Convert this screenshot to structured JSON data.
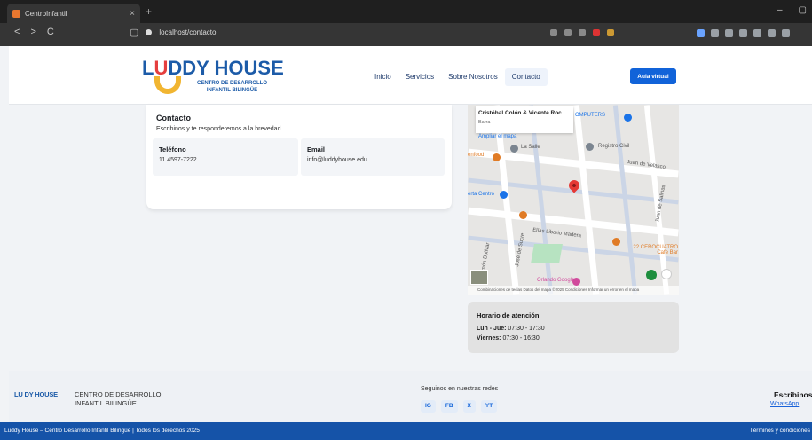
{
  "browser": {
    "tab_title": "CentroInfantil",
    "tab_close": "×",
    "new_tab": "+",
    "url": "localhost/contacto",
    "nav": {
      "back": "<",
      "forward": ">",
      "reload": "C"
    }
  },
  "header": {
    "logo": {
      "l": "L",
      "u": "U",
      "d": "D",
      "rest": "DY HOUSE",
      "sub1": "CENTRO DE DESARROLLO",
      "sub2": "INFANTIL BILINGÜE"
    },
    "menu": [
      "Inicio",
      "Servicios",
      "Sobre Nosotros",
      "Contacto"
    ],
    "active_menu": "Contacto",
    "cta": "Aula virtual"
  },
  "contact": {
    "title": "Contacto",
    "subtitle": "Escribinos y te responderemos a la brevedad.",
    "phone_label": "Teléfono",
    "phone_value": "11 4597-7222",
    "email_label": "Email",
    "email_value": "info@luddyhouse.edu"
  },
  "map": {
    "tooltip_title": "Cristóbal Colón & Vicente Roc...",
    "tooltip_sub": "Barra",
    "expand_link": "Ampliar el mapa",
    "labels": {
      "registro": "Registro Civil",
      "lasalle": "La Salle",
      "velasco": "Juan de Velasco",
      "liborio": "Elías Liborio Madera",
      "centro": "erta Centro",
      "computers": "OMPUTERS",
      "rest": "22 CEROCUATRO Cafe Bar",
      "orlando": "Orlando Google",
      "sucre": "José de Sucre",
      "bolivar": "Simón Bolívar",
      "salinas": "Juan de Salinas",
      "enfood": "enfood"
    },
    "footer": "Combinaciones de teclas  Datos del mapa ©2025  Condiciones  Informar un error en el mapa"
  },
  "horario": {
    "title": "Horario de atención",
    "rows": [
      {
        "day": "Lun - Jue:",
        "hours": "07:30 - 17:30"
      },
      {
        "day": "Viernes:",
        "hours": "07:30 - 16:30"
      }
    ]
  },
  "footer": {
    "brand": "LU DY HOUSE",
    "name1": "CENTRO DE DESARROLLO",
    "name2": "INFANTIL BILINGÜE",
    "social_title": "Seguinos en nuestras redes",
    "social": [
      "IG",
      "FB",
      "X",
      "YT"
    ],
    "escribinos": "Escribinos",
    "whatsapp_alt": "WhatsApp",
    "copyright": "Luddy House – Centro Desarrollo Infantil Bilingüe | Todos los derechos 2025",
    "terms": "Términos y condiciones"
  },
  "colors": {
    "brand_blue": "#1c5ba8",
    "accent_red": "#e53e3e",
    "accent_yellow": "#f1b531",
    "cta_blue": "#1163d9",
    "footer_bar": "#1553a8"
  }
}
